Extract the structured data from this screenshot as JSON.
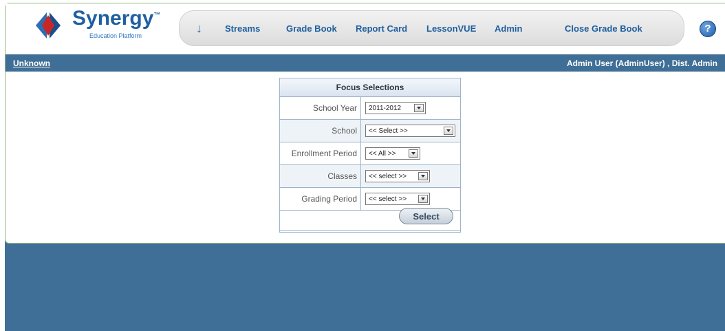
{
  "app": {
    "logo_text": "Synergy",
    "logo_tm": "™",
    "logo_subtitle": "Education Platform"
  },
  "nav": {
    "items": [
      "Streams",
      "Grade Book",
      "Report Card",
      "LessonVUE",
      "Admin",
      "Close Grade Book"
    ],
    "help_label": "?"
  },
  "status": {
    "left_link": "Unknown",
    "user_info": "Admin User (AdminUser) , Dist. Admin"
  },
  "focus": {
    "title": "Focus Selections",
    "rows": [
      {
        "label": "School Year",
        "value": "2011-2012"
      },
      {
        "label": "School",
        "value": "<< Select >>"
      },
      {
        "label": "Enrollment Period",
        "value": "<< All >>"
      },
      {
        "label": "Classes",
        "value": "<< select >>"
      },
      {
        "label": "Grading Period",
        "value": "<< select >>"
      }
    ],
    "button_label": "Select"
  },
  "colors": {
    "brand_blue": "#1f5fa3",
    "status_bar": "#3f6e96"
  },
  "icons": [
    "diamond-logo-icon",
    "arrow-down-icon",
    "help-icon",
    "chevron-down-icon"
  ]
}
